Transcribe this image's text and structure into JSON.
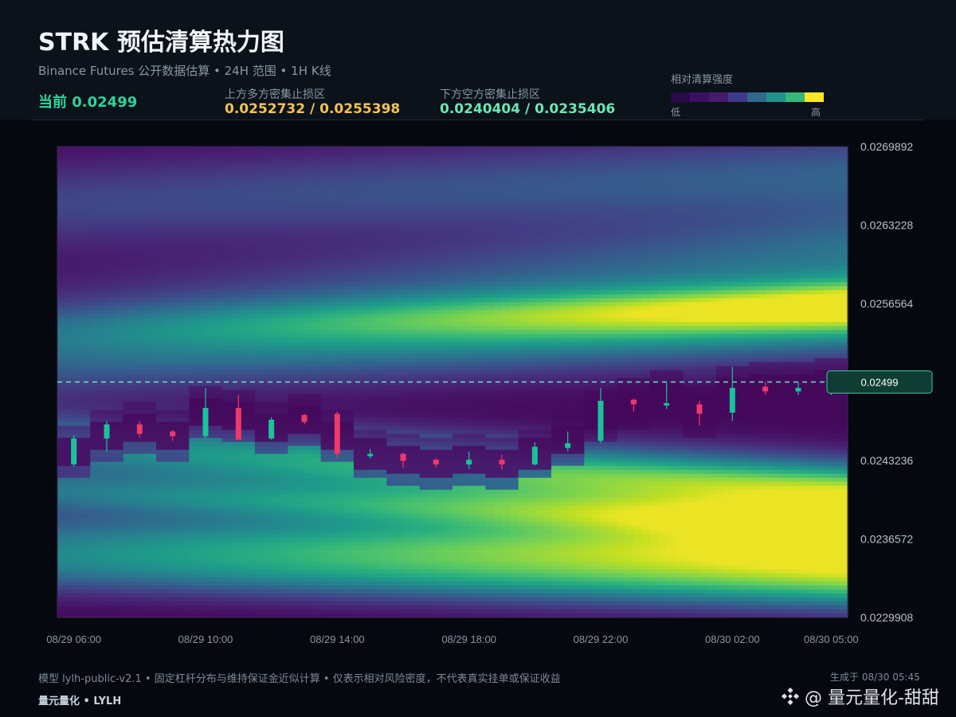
{
  "header": {
    "title": "STRK 预估清算热力图",
    "subtitle": "Binance Futures 公开数据估算 • 24H 范围 • 1H K线",
    "current_label": "当前 0.02499",
    "upper_zone_label": "上方多方密集止损区",
    "upper_zone_value": "0.0252732 / 0.0255398",
    "lower_zone_label": "下方空方密集止损区",
    "lower_zone_value": "0.0240404 / 0.0235406",
    "legend_title": "相对清算强度",
    "legend_low": "低",
    "legend_high": "高"
  },
  "colors": {
    "viridis": [
      "#440154",
      "#482173",
      "#433e85",
      "#38588c",
      "#2d708e",
      "#25858e",
      "#1e9b8a",
      "#2ab07f",
      "#52c569",
      "#86d549",
      "#c2df23",
      "#fde725"
    ],
    "legend_swatches": [
      "#2a0a4a",
      "#3b0f63",
      "#481a6c",
      "#3e3a8c",
      "#31688e",
      "#21918c",
      "#35b779",
      "#fde725"
    ],
    "up_candle": "#19c39a",
    "down_candle": "#f0386b",
    "current_line": "#6fe3c6"
  },
  "chart_data": {
    "type": "heatmap",
    "current_price": 0.02499,
    "current_price_label": "0.02499",
    "y_ticks": [
      "0.0269892",
      "0.0263228",
      "0.0256564",
      "0.0243236",
      "0.0236572",
      "0.0229908"
    ],
    "ylim": [
      0.0229908,
      0.0269892
    ],
    "x_ticks": [
      "08/29 06:00",
      "08/29 10:00",
      "08/29 14:00",
      "08/29 18:00",
      "08/29 22:00",
      "08/30 02:00",
      "08/30 05:00"
    ],
    "x_range_hours": [
      0,
      24
    ],
    "candles": [
      {
        "t": 0.5,
        "open": 0.02429,
        "close": 0.02451,
        "high": 0.02454,
        "low": 0.02427
      },
      {
        "t": 1.5,
        "open": 0.02451,
        "close": 0.02463,
        "high": 0.02466,
        "low": 0.0244
      },
      {
        "t": 2.5,
        "open": 0.02463,
        "close": 0.02455,
        "high": 0.02466,
        "low": 0.02452
      },
      {
        "t": 3.5,
        "open": 0.02457,
        "close": 0.02453,
        "high": 0.02458,
        "low": 0.02449
      },
      {
        "t": 4.5,
        "open": 0.02453,
        "close": 0.02477,
        "high": 0.02494,
        "low": 0.02451
      },
      {
        "t": 5.5,
        "open": 0.02477,
        "close": 0.0245,
        "high": 0.02488,
        "low": 0.0245
      },
      {
        "t": 6.5,
        "open": 0.02451,
        "close": 0.02467,
        "high": 0.02469,
        "low": 0.0245
      },
      {
        "t": 7.5,
        "open": 0.02471,
        "close": 0.02465,
        "high": 0.02472,
        "low": 0.02463
      },
      {
        "t": 8.5,
        "open": 0.02472,
        "close": 0.02438,
        "high": 0.02474,
        "low": 0.02434
      },
      {
        "t": 9.5,
        "open": 0.02437,
        "close": 0.02438,
        "high": 0.02442,
        "low": 0.02434
      },
      {
        "t": 10.5,
        "open": 0.02438,
        "close": 0.02432,
        "high": 0.02439,
        "low": 0.02426
      },
      {
        "t": 11.5,
        "open": 0.02433,
        "close": 0.02429,
        "high": 0.02434,
        "low": 0.02426
      },
      {
        "t": 12.5,
        "open": 0.02429,
        "close": 0.02433,
        "high": 0.0244,
        "low": 0.02425
      },
      {
        "t": 13.5,
        "open": 0.02433,
        "close": 0.02429,
        "high": 0.02437,
        "low": 0.02425
      },
      {
        "t": 14.5,
        "open": 0.02429,
        "close": 0.02444,
        "high": 0.02448,
        "low": 0.02428
      },
      {
        "t": 15.5,
        "open": 0.02443,
        "close": 0.02447,
        "high": 0.02457,
        "low": 0.0244
      },
      {
        "t": 16.5,
        "open": 0.02449,
        "close": 0.02483,
        "high": 0.02494,
        "low": 0.02447
      },
      {
        "t": 17.5,
        "open": 0.02484,
        "close": 0.0248,
        "high": 0.02485,
        "low": 0.02474
      },
      {
        "t": 18.5,
        "open": 0.02479,
        "close": 0.02481,
        "high": 0.02499,
        "low": 0.02476
      },
      {
        "t": 19.5,
        "open": 0.0248,
        "close": 0.02472,
        "high": 0.02483,
        "low": 0.02462
      },
      {
        "t": 20.5,
        "open": 0.02473,
        "close": 0.02494,
        "high": 0.02512,
        "low": 0.02466
      },
      {
        "t": 21.5,
        "open": 0.02495,
        "close": 0.02491,
        "high": 0.02499,
        "low": 0.02488
      },
      {
        "t": 22.5,
        "open": 0.02491,
        "close": 0.02494,
        "high": 0.02499,
        "low": 0.02488
      },
      {
        "t": 23.5,
        "open": 0.02494,
        "close": 0.02499,
        "high": 0.02504,
        "low": 0.02488
      }
    ],
    "density_bands": [
      {
        "center_start": 0.0252,
        "center_end": 0.02555,
        "width": 0.00022,
        "amp_start": 0.3,
        "amp_end": 0.65
      },
      {
        "center_start": 0.02545,
        "center_end": 0.02565,
        "width": 0.00014,
        "amp_start": 0.15,
        "amp_end": 0.55
      },
      {
        "center_start": 0.0256,
        "center_end": 0.0261,
        "width": 0.00025,
        "amp_start": 0.1,
        "amp_end": 0.35
      },
      {
        "center_start": 0.0265,
        "center_end": 0.02675,
        "width": 0.00025,
        "amp_start": 0.2,
        "amp_end": 0.3
      },
      {
        "center_start": 0.02445,
        "center_end": 0.02404,
        "width": 0.00018,
        "amp_start": 0.45,
        "amp_end": 0.98
      },
      {
        "center_start": 0.02405,
        "center_end": 0.02378,
        "width": 0.00012,
        "amp_start": 0.35,
        "amp_end": 0.7
      },
      {
        "center_start": 0.02365,
        "center_end": 0.02354,
        "width": 0.00017,
        "amp_start": 0.35,
        "amp_end": 1.0
      },
      {
        "center_start": 0.0234,
        "center_end": 0.02325,
        "width": 0.00015,
        "amp_start": 0.3,
        "amp_end": 0.55
      }
    ]
  },
  "footer": {
    "note": "模型 lylh-public-v2.1 • 固定杠杆分布与维持保证金近似计算 • 仅表示相对风险密度，不代表真实挂单或保证收益",
    "brand": "量元量化 • LYLH",
    "generated": "生成于 08/30 05:45",
    "watermark": "@ 量元量化-甜甜"
  }
}
